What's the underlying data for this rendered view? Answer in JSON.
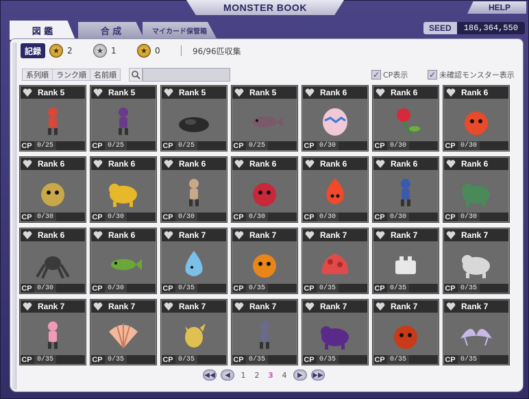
{
  "window": {
    "title": "MONSTER BOOK",
    "help_label": "HELP",
    "seed_label": "SEED",
    "seed_value": "186,364,550"
  },
  "tabs": [
    {
      "label": "図 鑑",
      "active": true
    },
    {
      "label": "合 成",
      "active": false
    },
    {
      "label": "マイカード保管箱",
      "active": false
    }
  ],
  "stats": {
    "record_label": "記録",
    "gold_count": "2",
    "silver_count": "1",
    "bronze_count": "0",
    "collected": "96/96匹収集"
  },
  "sort": [
    "系列順",
    "ランク順",
    "名前順"
  ],
  "search": {
    "placeholder": "",
    "value": ""
  },
  "options": {
    "cp_label": "CP表示",
    "unconfirmed_label": "未確認モンスター表示"
  },
  "cp_prefix": "CP",
  "monsters": [
    {
      "rank": "Rank 5",
      "cp": "0/25",
      "color": "#d9473a",
      "shape": "humanoid"
    },
    {
      "rank": "Rank 5",
      "cp": "0/25",
      "color": "#6a3a8a",
      "shape": "humanoid"
    },
    {
      "rank": "Rank 5",
      "cp": "0/25",
      "color": "#2a2a2a",
      "shape": "rock"
    },
    {
      "rank": "Rank 5",
      "cp": "0/25",
      "color": "#7a5a6a",
      "shape": "fish"
    },
    {
      "rank": "Rank 6",
      "cp": "0/30",
      "color": "#f0c8d8",
      "shape": "egg"
    },
    {
      "rank": "Rank 6",
      "cp": "0/30",
      "color": "#d62a3a",
      "shape": "plant"
    },
    {
      "rank": "Rank 6",
      "cp": "0/30",
      "color": "#e84a2a",
      "shape": "round"
    },
    {
      "rank": "Rank 6",
      "cp": "0/30",
      "color": "#c9a84a",
      "shape": "round"
    },
    {
      "rank": "Rank 6",
      "cp": "0/30",
      "color": "#e6b82a",
      "shape": "beast"
    },
    {
      "rank": "Rank 6",
      "cp": "0/30",
      "color": "#c8a888",
      "shape": "humanoid"
    },
    {
      "rank": "Rank 6",
      "cp": "0/30",
      "color": "#c8283a",
      "shape": "round"
    },
    {
      "rank": "Rank 6",
      "cp": "0/30",
      "color": "#f04a2a",
      "shape": "flame"
    },
    {
      "rank": "Rank 6",
      "cp": "0/30",
      "color": "#3a5ab0",
      "shape": "humanoid"
    },
    {
      "rank": "Rank 6",
      "cp": "0/30",
      "color": "#4a8a5a",
      "shape": "beast"
    },
    {
      "rank": "Rank 6",
      "cp": "0/30",
      "color": "#3a3a3a",
      "shape": "spider"
    },
    {
      "rank": "Rank 6",
      "cp": "0/30",
      "color": "#6aa83a",
      "shape": "fish"
    },
    {
      "rank": "Rank 7",
      "cp": "0/35",
      "color": "#7ac0e8",
      "shape": "drop"
    },
    {
      "rank": "Rank 7",
      "cp": "0/35",
      "color": "#e8861a",
      "shape": "round"
    },
    {
      "rank": "Rank 7",
      "cp": "0/35",
      "color": "#e04a4a",
      "shape": "blob"
    },
    {
      "rank": "Rank 7",
      "cp": "0/35",
      "color": "#e8e8e8",
      "shape": "box"
    },
    {
      "rank": "Rank 7",
      "cp": "0/35",
      "color": "#d8d8d8",
      "shape": "beast"
    },
    {
      "rank": "Rank 7",
      "cp": "0/35",
      "color": "#f09ab8",
      "shape": "humanoid"
    },
    {
      "rank": "Rank 7",
      "cp": "0/35",
      "color": "#f2b89a",
      "shape": "shell"
    },
    {
      "rank": "Rank 7",
      "cp": "0/35",
      "color": "#e0c050",
      "shape": "bird"
    },
    {
      "rank": "Rank 7",
      "cp": "0/35",
      "color": "#6a6a8a",
      "shape": "humanoid"
    },
    {
      "rank": "Rank 7",
      "cp": "0/35",
      "color": "#5a2a8a",
      "shape": "beast"
    },
    {
      "rank": "Rank 7",
      "cp": "0/35",
      "color": "#c83a1a",
      "shape": "round"
    },
    {
      "rank": "Rank 7",
      "cp": "0/35",
      "color": "#c8b8e8",
      "shape": "wing"
    }
  ],
  "pager": {
    "pages": [
      "1",
      "2",
      "3",
      "4"
    ],
    "current": "3"
  }
}
